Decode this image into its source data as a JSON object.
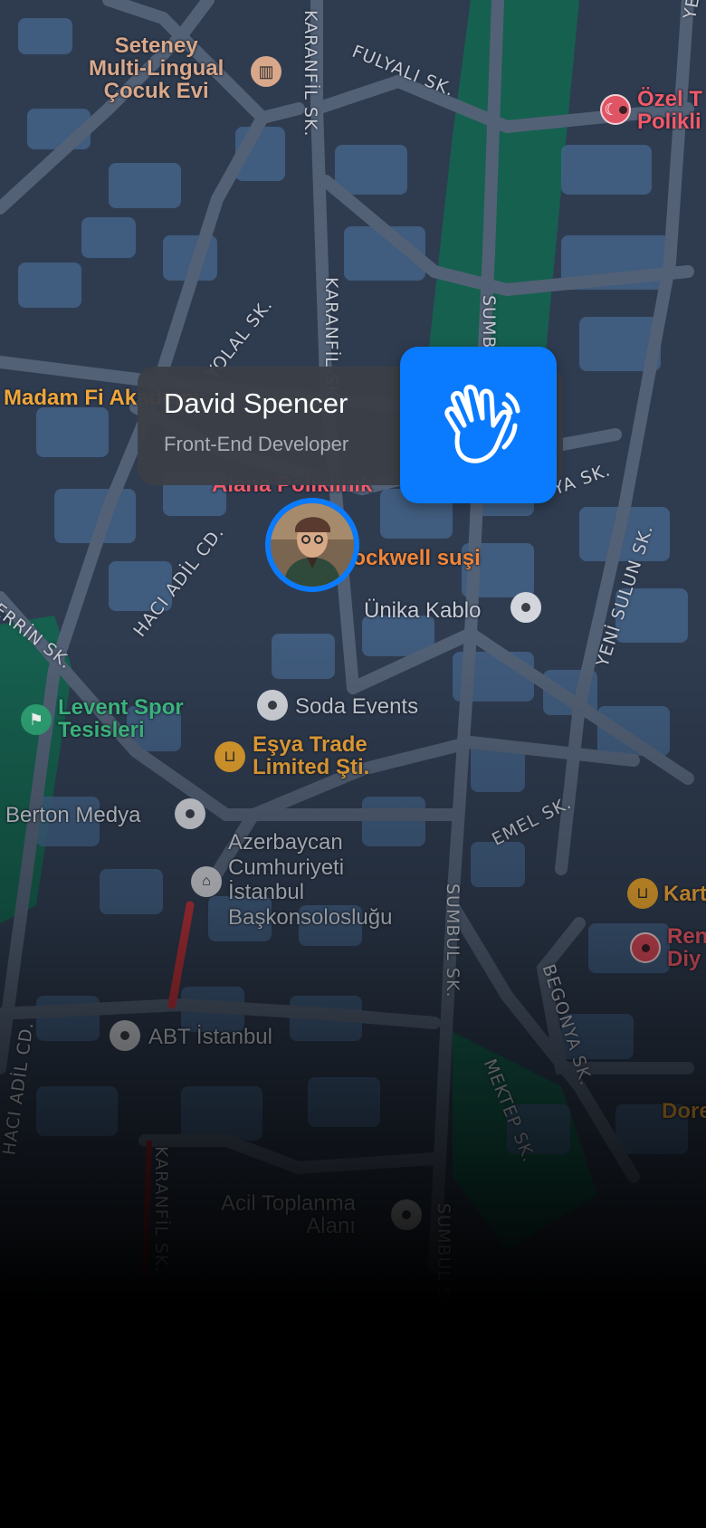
{
  "map": {
    "places": {
      "seteney": "Seteney\nMulti-Lingual\nÇocuk Evi",
      "ozel": "Özel T\nPolikli",
      "madam": "Madam Fi Akademi",
      "alana": "Alana Poliklinik",
      "rockwell": "Rockwell suşi",
      "unika": "Ünika Kablo",
      "levent": "Levent Spor\nTesisleri",
      "soda": "Soda Events",
      "esya": "Eşya Trade\nLimited Şti.",
      "berton": "Berton Medya",
      "azerbaycan": "Azerbaycan\nCumhuriyeti\nİstanbul\nBaşkonsolosluğu",
      "kart": "Kart",
      "ren": "Ren\nDiy",
      "abt": "ABT İstanbul",
      "dore": "Dore",
      "acil": "Acil Toplanma\nAlanı"
    },
    "streets": {
      "karanfil_top": "KARANFİL SK.",
      "fulyali": "FULYALI SK.",
      "yeni_top": "YENİ",
      "sumbul_top": "SUMBUL",
      "karanfil_mid": "KARANFİL SK.",
      "yolal": "YOLAL SK.",
      "hacı_adil_mid": "HACI ADİL CD.",
      "erin": "ERRİN SK.",
      "ya": "YA SK.",
      "yeni_sulun": "YENİ SULUN SK.",
      "emel": "EMEL SK.",
      "sumbul_mid": "SUMBUL SK.",
      "begonya": "BEGONYA SK.",
      "hacı_adil_low": "HACI ADİL CD.",
      "mektep": "MEKTEP SK.",
      "karanfil_low": "KARANFİL SK.",
      "sumbul_low": "SUMBUL SK."
    }
  },
  "profile": {
    "name": "David Spencer",
    "role": "Front-End Developer",
    "wave_icon": "waving-hand-icon",
    "accent": "#0a7bff"
  }
}
